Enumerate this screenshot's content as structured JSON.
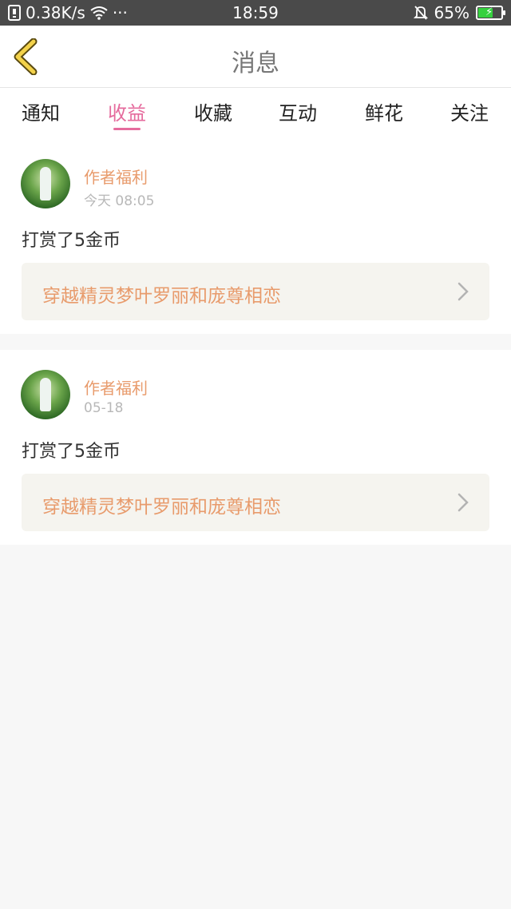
{
  "status_bar": {
    "network_speed": "0.38K/s",
    "dots": "···",
    "time": "18:59",
    "battery": "65%",
    "battery_level": 0.65
  },
  "header": {
    "title": "消息",
    "back_icon": "chevron-left-icon"
  },
  "tabs": [
    {
      "label": "通知"
    },
    {
      "label": "收益"
    },
    {
      "label": "收藏"
    },
    {
      "label": "互动"
    },
    {
      "label": "鲜花"
    },
    {
      "label": "关注"
    }
  ],
  "active_tab": "收益",
  "colors": {
    "accent": "#e56b9d",
    "author": "#e89b6c"
  },
  "items": [
    {
      "author": "作者福利",
      "time": "今天 08:05",
      "message": "打赏了5金币",
      "book_title": "穿越精灵梦叶罗丽和庞尊相恋"
    },
    {
      "author": "作者福利",
      "time": "05-18",
      "message": "打赏了5金币",
      "book_title": "穿越精灵梦叶罗丽和庞尊相恋"
    }
  ]
}
